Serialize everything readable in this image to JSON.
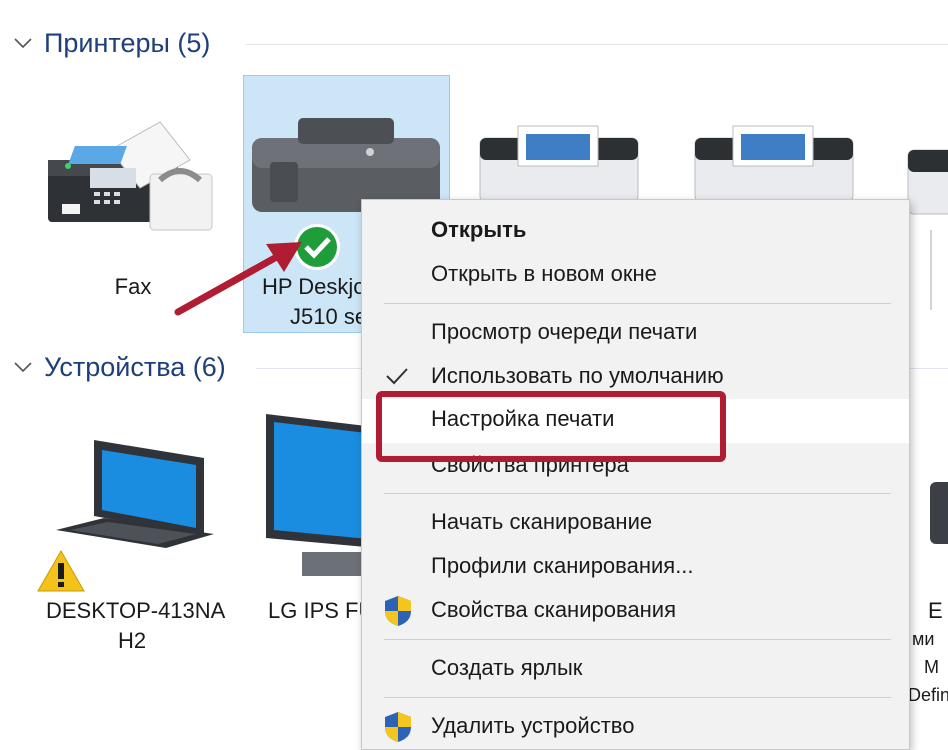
{
  "sections": {
    "printers": {
      "title": "Принтеры (5)"
    },
    "devices": {
      "title": "Устройства (6)"
    }
  },
  "printers": {
    "fax": {
      "label": "Fax"
    },
    "hp": {
      "label_line1": "HP Deskjo",
      "label_line2": "J510 se"
    }
  },
  "devices": {
    "desktop": {
      "label_line1": "DESKTOP-413NA",
      "label_line2": "H2"
    },
    "monitor": {
      "label": "LG IPS FU"
    },
    "right_partial": {
      "line1": "E",
      "line2": "ми",
      "line3": "M",
      "line4": "Defin"
    }
  },
  "context_menu": {
    "items": [
      {
        "label": "Открыть",
        "bold": true
      },
      {
        "label": "Открыть в новом окне"
      },
      {
        "label": "Просмотр очереди печати"
      },
      {
        "label": "Использовать по умолчанию",
        "checked": true
      },
      {
        "label": "Настройка печати",
        "highlighted": true
      },
      {
        "label": "Свойства принтера"
      },
      {
        "label": "Начать сканирование"
      },
      {
        "label": "Профили сканирования..."
      },
      {
        "label": "Свойства сканирования",
        "icon": "shield-icon"
      },
      {
        "label": "Создать ярлык"
      },
      {
        "label": "Удалить устройство",
        "icon": "shield-icon"
      }
    ]
  },
  "colors": {
    "section_title": "#1e3f7a",
    "selection_bg": "#cde6f7",
    "annotation_red": "#b01d32",
    "default_check_green": "#1f9d3a"
  }
}
